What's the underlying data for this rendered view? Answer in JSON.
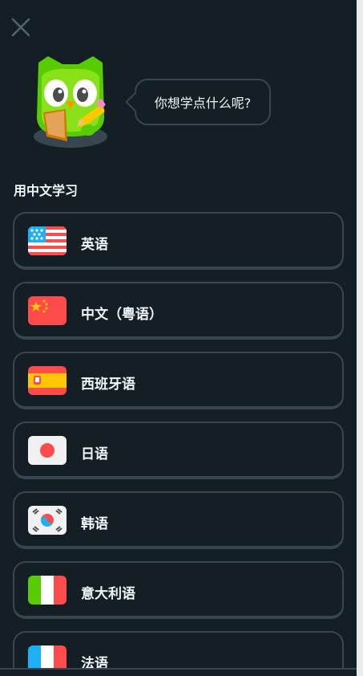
{
  "header": {
    "close_icon": "close-icon"
  },
  "mascot": {
    "icon": "owl-mascot-icon",
    "speech": "你想学点什么呢?"
  },
  "section": {
    "title": "用中文学习"
  },
  "languages": [
    {
      "label": "英语",
      "flag": "us-flag-icon"
    },
    {
      "label": "中文（粤语）",
      "flag": "china-flag-icon"
    },
    {
      "label": "西班牙语",
      "flag": "spain-flag-icon"
    },
    {
      "label": "日语",
      "flag": "japan-flag-icon"
    },
    {
      "label": "韩语",
      "flag": "korea-flag-icon"
    },
    {
      "label": "意大利语",
      "flag": "italy-flag-icon"
    },
    {
      "label": "法语",
      "flag": "france-flag-icon"
    }
  ],
  "colors": {
    "background": "#131f24",
    "border": "#37464f",
    "text": "#f1f7fb",
    "mascot_green": "#58cc02"
  }
}
